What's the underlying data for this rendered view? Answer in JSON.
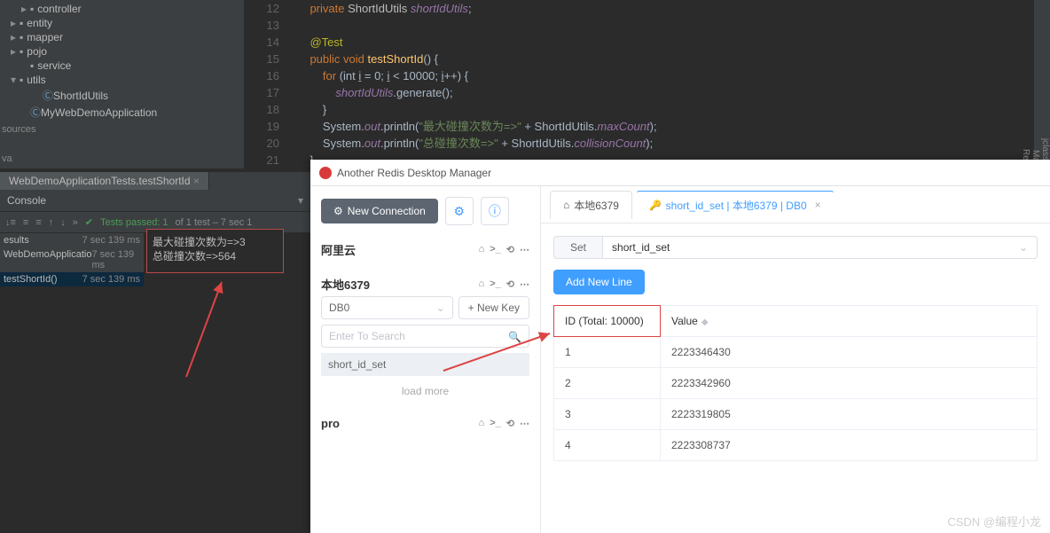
{
  "tree": {
    "items": [
      {
        "indent": 20,
        "chev": "▸",
        "icon": "📁",
        "label": "controller"
      },
      {
        "indent": 8,
        "chev": "▸",
        "icon": "📁",
        "label": "entity"
      },
      {
        "indent": 8,
        "chev": "▸",
        "icon": "📁",
        "label": "mapper"
      },
      {
        "indent": 8,
        "chev": "▸",
        "icon": "📁",
        "label": "pojo"
      },
      {
        "indent": 20,
        "chev": "",
        "icon": "📁",
        "label": "service"
      },
      {
        "indent": 8,
        "chev": "▾",
        "icon": "📁",
        "label": "utils"
      },
      {
        "indent": 34,
        "chev": "",
        "icon": "Ⓒ",
        "label": "ShortIdUtils"
      },
      {
        "indent": 20,
        "chev": "",
        "icon": "Ⓒ",
        "label": "MyWebDemoApplication"
      }
    ],
    "sources": "sources",
    "java": "va"
  },
  "editor": {
    "gutter": [
      "12",
      "13",
      "14",
      "15",
      "16",
      "17",
      "18",
      "19",
      "20",
      "21"
    ],
    "lines": {
      "l12": "private ShortIdUtils shortIdUtils;",
      "l14": "@Test",
      "l15a": "public void ",
      "l15b": "testShortId",
      "l15c": "() {",
      "l16a": "for ",
      "l16b": "(int ",
      "l16c": "i",
      "l16d": " = 0; ",
      "l16e": " < 10000; ",
      "l16f": "++) {",
      "l17a": "shortIdUtils",
      "l17b": ".generate();",
      "l18": "}",
      "l19a": "System.",
      "l19b": "out",
      "l19c": ".println(",
      "l19str": "\"最大碰撞次数为=>\"",
      "l19d": " + ShortIdUtils.",
      "l19e": "maxCount",
      "l19f": ");",
      "l20str": "\"总碰撞次数=>\"",
      "l20e": "collisionCount",
      "l21": "}"
    }
  },
  "tab": {
    "name": "WebDemoApplicationTests.testShortId"
  },
  "console": {
    "title": "Console",
    "passed": "Tests passed: 1",
    "passed_sub": " of 1 test – 7 sec 1"
  },
  "results": [
    {
      "label": "esults",
      "time": "7 sec 139 ms"
    },
    {
      "label": "WebDemoApplicatio",
      "time": "7 sec 139 ms"
    },
    {
      "label": "testShortId()",
      "time": "7 sec 139 ms",
      "sel": true
    }
  ],
  "output": {
    "line1": "最大碰撞次数为=>3",
    "line2": "总碰撞次数=>564"
  },
  "rail": [
    "jclasslib",
    "Maven",
    "RestSe"
  ],
  "redis": {
    "title": "Another Redis Desktop Manager",
    "new_conn": "New Connection",
    "conns": [
      {
        "name": "阿里云"
      },
      {
        "name": "本地6379",
        "expanded": true
      },
      {
        "name": "pro"
      }
    ],
    "db": "DB0",
    "new_key": "New Key",
    "search_ph": "Enter To Search",
    "key_item": "short_id_set",
    "load_more": "load more",
    "tabs": [
      {
        "label": "本地6379",
        "icon": "home"
      },
      {
        "label": "short_id_set | 本地6379 | DB0",
        "icon": "key",
        "active": true
      }
    ],
    "type_label": "Set",
    "key_name": "short_id_set",
    "add_line": "Add New Line",
    "col_id": "ID (Total: 10000)",
    "col_val": "Value",
    "rows": [
      {
        "id": "1",
        "val": "2223346430"
      },
      {
        "id": "2",
        "val": "2223342960"
      },
      {
        "id": "3",
        "val": "2223319805"
      },
      {
        "id": "4",
        "val": "2223308737"
      }
    ]
  },
  "watermark": "CSDN @编程小龙"
}
